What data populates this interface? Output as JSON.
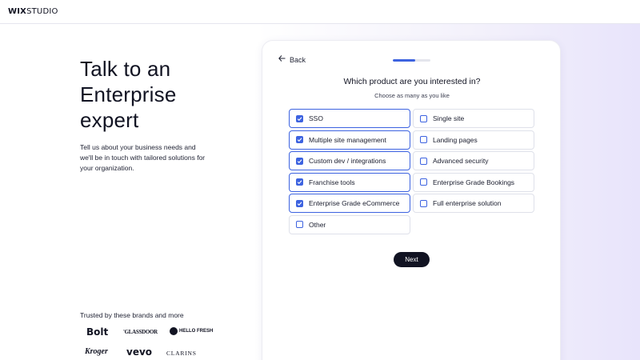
{
  "header": {
    "logo_bold": "WIX",
    "logo_light": "STUDIO"
  },
  "hero": {
    "headline_lines": [
      "Talk to an",
      "Enterprise",
      "expert"
    ],
    "intro_lines": [
      "Tell us about your business needs and",
      "we'll be in touch with tailored solutions for",
      "your organization."
    ]
  },
  "brands": {
    "label": "Trusted by these brands and more",
    "items": [
      "Bolt",
      "GLASSDOOR",
      "HELLO FRESH",
      "Kroger",
      "vevo",
      "CLARINS"
    ]
  },
  "form": {
    "back_label": "Back",
    "progress": 0.6,
    "question": "Which product are you interested in?",
    "subtitle": "Choose as many as you like",
    "options_left": [
      {
        "label": "SSO",
        "checked": true
      },
      {
        "label": "Multiple site management",
        "checked": true
      },
      {
        "label": "Custom dev / integrations",
        "checked": true
      },
      {
        "label": "Franchise tools",
        "checked": true
      },
      {
        "label": "Enterprise Grade eCommerce",
        "checked": true
      },
      {
        "label": "Other",
        "checked": false
      }
    ],
    "options_right": [
      {
        "label": "Single site",
        "checked": false
      },
      {
        "label": "Landing pages",
        "checked": false
      },
      {
        "label": "Advanced security",
        "checked": false
      },
      {
        "label": "Enterprise Grade Bookings",
        "checked": false
      },
      {
        "label": "Full enterprise solution",
        "checked": false
      }
    ],
    "next_label": "Next"
  },
  "colors": {
    "accent": "#3d63e0",
    "dark": "#111322"
  }
}
